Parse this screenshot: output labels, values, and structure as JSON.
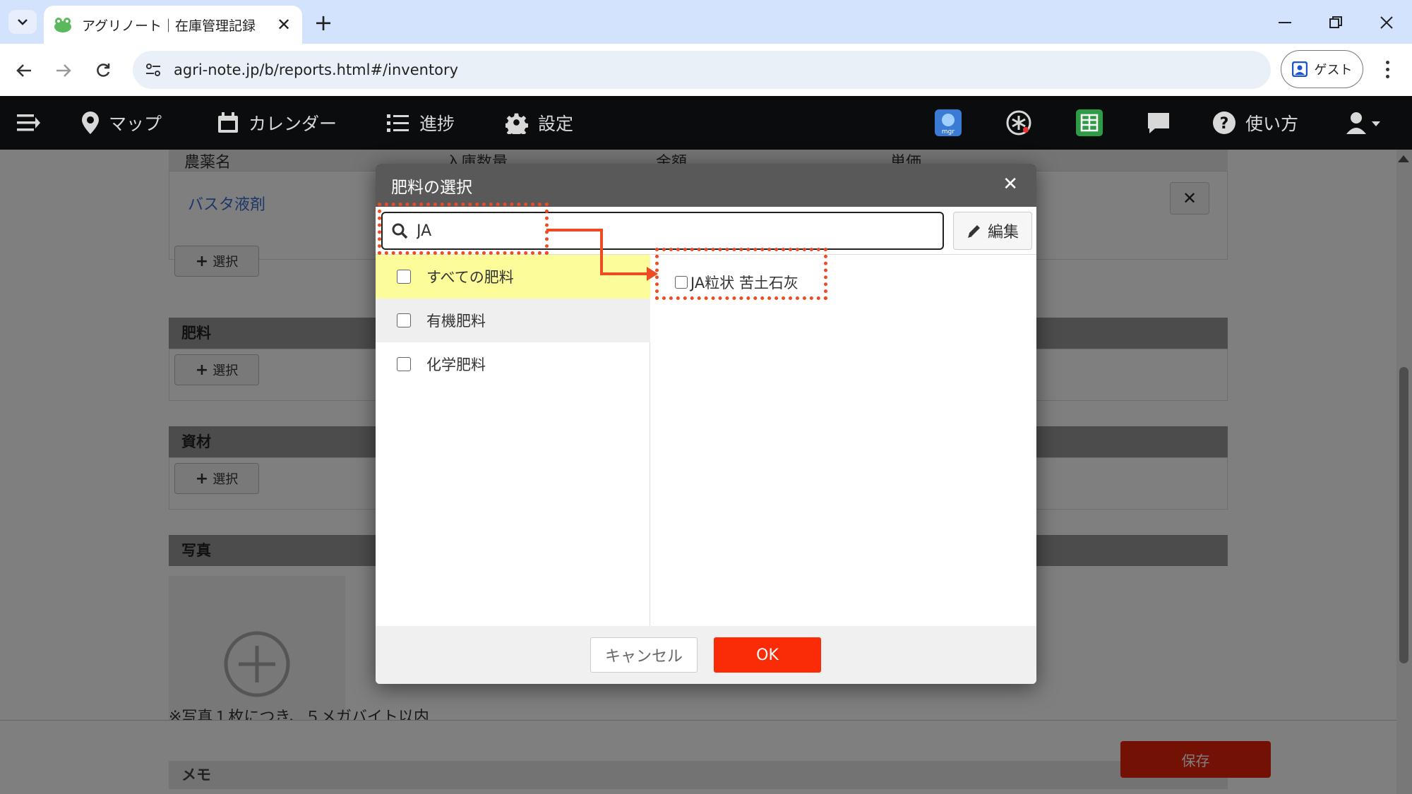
{
  "browser": {
    "tab_title": "アグリノート｜在庫管理記録",
    "url": "agri-note.jp/b/reports.html#/inventory",
    "profile_label": "ゲスト"
  },
  "navbar": {
    "items": [
      {
        "label": "マップ",
        "icon": "map-pin-icon"
      },
      {
        "label": "カレンダー",
        "icon": "calendar-icon"
      },
      {
        "label": "進捗",
        "icon": "checklist-icon"
      },
      {
        "label": "設定",
        "icon": "gear-icon"
      }
    ],
    "help_label": "使い方"
  },
  "background_page": {
    "pesticide_columns": [
      "農薬名",
      "入庫数量",
      "金額",
      "単価"
    ],
    "pesticide_row_name": "バスタ液剤",
    "select_label": "選択",
    "fertilizer_section": "肥料",
    "materials_section": "資材",
    "photo_section": "写真",
    "photo_note": "※写真１枚につき、５メガバイト以内",
    "memo_section": "メモ",
    "save_label": "保存"
  },
  "modal": {
    "title": "肥料の選択",
    "search_value": "JA",
    "edit_label": "編集",
    "categories": [
      {
        "label": "すべての肥料",
        "selected": true
      },
      {
        "label": "有機肥料",
        "selected": false
      },
      {
        "label": "化学肥料",
        "selected": false
      }
    ],
    "results": [
      {
        "label": "JA粒状 苦土石灰",
        "checked": false
      }
    ],
    "cancel_label": "キャンセル",
    "ok_label": "OK"
  },
  "colors": {
    "accent_red": "#fa2c07",
    "highlight": "#ee4a23",
    "selected_row": "#fcfc9a"
  }
}
